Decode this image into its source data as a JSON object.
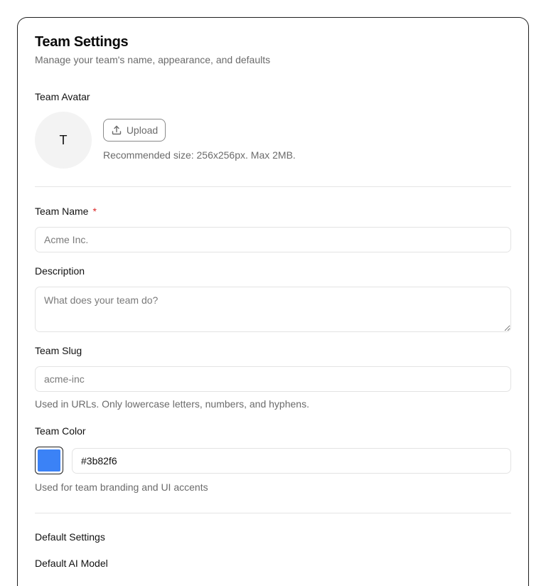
{
  "header": {
    "title": "Team Settings",
    "subtitle": "Manage your team's name, appearance, and defaults"
  },
  "avatar": {
    "label": "Team Avatar",
    "initial": "T",
    "upload_label": "Upload",
    "upload_icon": "upload-icon",
    "hint": "Recommended size: 256x256px. Max 2MB."
  },
  "team_name": {
    "label": "Team Name",
    "required_mark": "*",
    "value": "",
    "placeholder": "Acme Inc."
  },
  "description": {
    "label": "Description",
    "value": "",
    "placeholder": "What does your team do?"
  },
  "slug": {
    "label": "Team Slug",
    "value": "",
    "placeholder": "acme-inc",
    "hint": "Used in URLs. Only lowercase letters, numbers, and hyphens."
  },
  "color": {
    "label": "Team Color",
    "value": "#3b82f6",
    "swatch_color": "#3b82f6",
    "hint": "Used for team branding and UI accents"
  },
  "defaults": {
    "section_title": "Default Settings",
    "ai_model_label": "Default AI Model"
  }
}
